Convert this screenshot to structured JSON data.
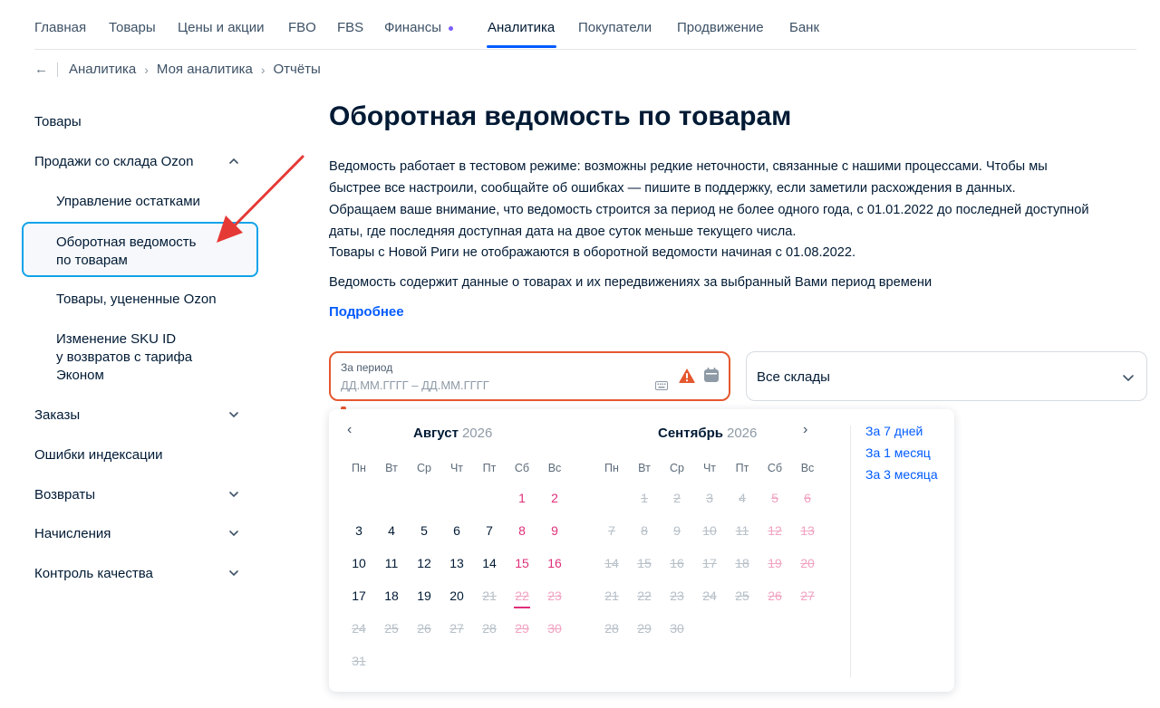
{
  "topnav": {
    "items": [
      "Главная",
      "Товары",
      "Цены и акции",
      "FBO",
      "FBS",
      "Финансы",
      "Аналитика",
      "Покупатели",
      "Продвижение",
      "Банк"
    ],
    "active": "Аналитика"
  },
  "breadcrumb": {
    "back_icon": "arrow-left-icon",
    "items": [
      "Аналитика",
      "Моя аналитика",
      "Отчёты"
    ]
  },
  "sidebar": {
    "items": [
      {
        "label": "Товары"
      },
      {
        "label": "Продажи со склада Ozon",
        "expanded": true
      },
      {
        "label": "Управление остатками"
      },
      {
        "label": "Оборотная ведомость\nпо товарам",
        "active": true
      },
      {
        "label": "Товары, уцененные Ozon"
      },
      {
        "label": "Изменение SKU ID\nу возвратов с тарифа\nЭконом"
      },
      {
        "label": "Заказы",
        "expanded": false
      },
      {
        "label": "Ошибки индексации"
      },
      {
        "label": "Возвраты",
        "expanded": false
      },
      {
        "label": "Начисления",
        "expanded": false
      },
      {
        "label": "Контроль качества",
        "expanded": false
      }
    ]
  },
  "main": {
    "title": "Оборотная ведомость по товарам",
    "paragraph_lines": [
      "Ведомость работает в тестовом режиме: возможны редкие неточности, связанные с нашими процессами. Чтобы мы",
      "быстрее все настроили, сообщайте об ошибках — пишите в поддержку, если заметили расхождения в данных.",
      "Обращаем ваше внимание, что ведомость строится за период не более одного года, с 01.01.2022 до последней доступной",
      "даты, где последняя доступная дата на двое суток меньше текущего числа.",
      "Товары с Новой Риги не отображаются в оборотной ведомости начиная с 01.08.2022."
    ],
    "paragraph2": "Ведомость содержит данные о товарах и их передвижениях за выбранный Вами период времени",
    "more_link": "Подробнее",
    "period": {
      "label": "За период",
      "placeholder": "ДД.ММ.ГГГГ – ДД.ММ.ГГГГ"
    },
    "warehouse": {
      "value": "Все склады"
    }
  },
  "calendar": {
    "weekdays": [
      "Пн",
      "Вт",
      "Ср",
      "Чт",
      "Пт",
      "Сб",
      "Вс"
    ],
    "left": {
      "month": "Август",
      "year": "2026",
      "first_weekday": 5,
      "days": 31,
      "last_enabled": 20,
      "today": 22
    },
    "right": {
      "month": "Сентябрь",
      "year": "2026",
      "first_weekday": 1,
      "days": 30,
      "last_enabled": 0
    },
    "quick": [
      "За 7 дней",
      "За 1 месяц",
      "За 3 месяца"
    ],
    "prev_icon": "chevron-left-icon",
    "next_icon": "chevron-right-icon"
  },
  "colors": {
    "accent": "#005bff",
    "error": "#e5572f",
    "weekend": "#e0307a",
    "active_border": "#10a3ea",
    "annotation": "#e53935"
  }
}
